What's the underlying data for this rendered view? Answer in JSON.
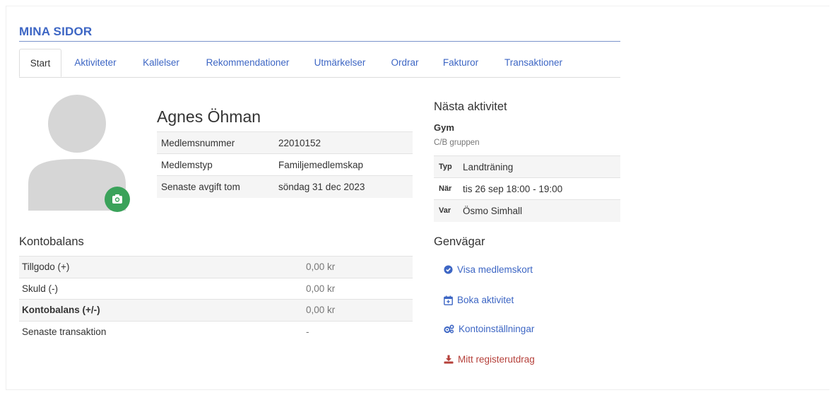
{
  "page": {
    "title": "MINA SIDOR"
  },
  "tabs": [
    {
      "label": "Start",
      "active": true
    },
    {
      "label": "Aktiviteter"
    },
    {
      "label": "Kallelser"
    },
    {
      "label": "Rekommendationer"
    },
    {
      "label": "Utmärkelser"
    },
    {
      "label": "Ordrar"
    },
    {
      "label": "Fakturor"
    },
    {
      "label": "Transaktioner"
    }
  ],
  "profile": {
    "name": "Agnes Öhman",
    "rows": [
      {
        "label": "Medlemsnummer",
        "value": "22010152"
      },
      {
        "label": "Medlemstyp",
        "value": "Familjemedlemskap"
      },
      {
        "label": "Senaste avgift tom",
        "value": "söndag 31 dec 2023"
      }
    ],
    "avatar_icon": "user-silhouette-icon",
    "camera_icon": "camera-icon",
    "camera_color": "#3aa25a"
  },
  "balance": {
    "heading": "Kontobalans",
    "rows": [
      {
        "label": "Tillgodo (+)",
        "value": "0,00 kr"
      },
      {
        "label": "Skuld (-)",
        "value": "0,00 kr"
      },
      {
        "label": "Kontobalans (+/-)",
        "value": "0,00 kr"
      },
      {
        "label": "Senaste transaktion",
        "value": "-"
      }
    ]
  },
  "next_activity": {
    "heading": "Nästa aktivitet",
    "name": "Gym",
    "group": "C/B gruppen",
    "rows": [
      {
        "label": "Typ",
        "value": "Landträning"
      },
      {
        "label": "När",
        "value": "tis 26 sep 18:00 - 19:00"
      },
      {
        "label": "Var",
        "value": "Ösmo Simhall"
      }
    ]
  },
  "shortcuts": {
    "heading": "Genvägar",
    "items": [
      {
        "label": "Visa medlemskort",
        "icon": "check-circle-icon",
        "color": "#3d66c4"
      },
      {
        "label": "Boka aktivitet",
        "icon": "calendar-plus-icon",
        "color": "#3d66c4"
      },
      {
        "label": "Kontoinställningar",
        "icon": "cogs-icon",
        "color": "#3d66c4"
      },
      {
        "label": "Mitt registerutdrag",
        "icon": "download-icon",
        "color": "#b5403a"
      }
    ]
  },
  "colors": {
    "accent": "#3d66c4",
    "success": "#3aa25a",
    "danger": "#b5403a"
  }
}
